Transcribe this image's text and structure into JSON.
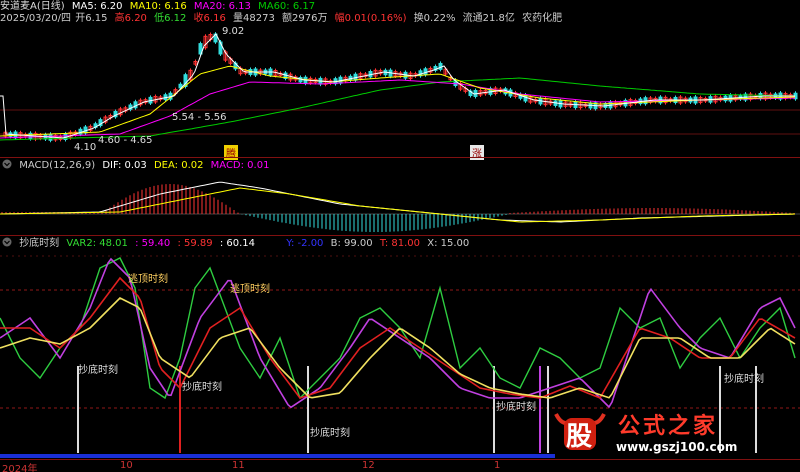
{
  "header": {
    "title": "安道麦A(日线)",
    "ma5": "MA5: 6.20",
    "ma10": "MA10: 6.16",
    "ma20": "MA20: 6.13",
    "ma60": "MA60: 6.17"
  },
  "info": {
    "date": "2025/03/20/四",
    "open": "开6.15",
    "high": "高6.20",
    "low": "低6.12",
    "close": "收6.16",
    "volume": "量48273",
    "amount": "额2976万",
    "change": "幅0.01(0.16%)",
    "turnover": "换0.22%",
    "float": "流通21.8亿",
    "sector": "农药化肥"
  },
  "price_notes": {
    "high_price": "9.02",
    "range_mid": "5.54 - 5.56",
    "range_low": "4.60 - 4.65",
    "low_price": "4.10"
  },
  "event_tags": [
    "腾",
    "涨"
  ],
  "macd": {
    "name": "MACD(12,26,9)",
    "dif": "DIF: 0.03",
    "dea": "DEA: 0.02",
    "macd": "MACD: 0.01"
  },
  "indicator": {
    "name": "抄底时刻",
    "var2": "VAR2: 48.01",
    "v1": ": 59.40",
    "v2": ": 59.89",
    "v3": ": 60.14",
    "y": "Y: -2.00",
    "b": "B: 99.00",
    "t": "T: 81.00",
    "x": "X: 15.00",
    "signals": [
      "逃顶时刻",
      "逃顶时刻",
      "抄底时刻",
      "抄底时刻",
      "抄底时刻",
      "抄底时刻",
      "抄底时刻"
    ]
  },
  "timeline": [
    "2024年",
    "10",
    "11",
    "12",
    "1"
  ],
  "watermark": {
    "logo_char": "股",
    "brand": "公式之家",
    "url": "www.gszj100.com"
  },
  "colors": {
    "up": "#ff3333",
    "down": "#33dddd",
    "ma5": "#ffffff",
    "ma10": "#ffff00",
    "ma20": "#ff00ff",
    "ma60": "#00cc00",
    "grid": "#801010",
    "blue_bar": "#1a2fd6"
  }
}
